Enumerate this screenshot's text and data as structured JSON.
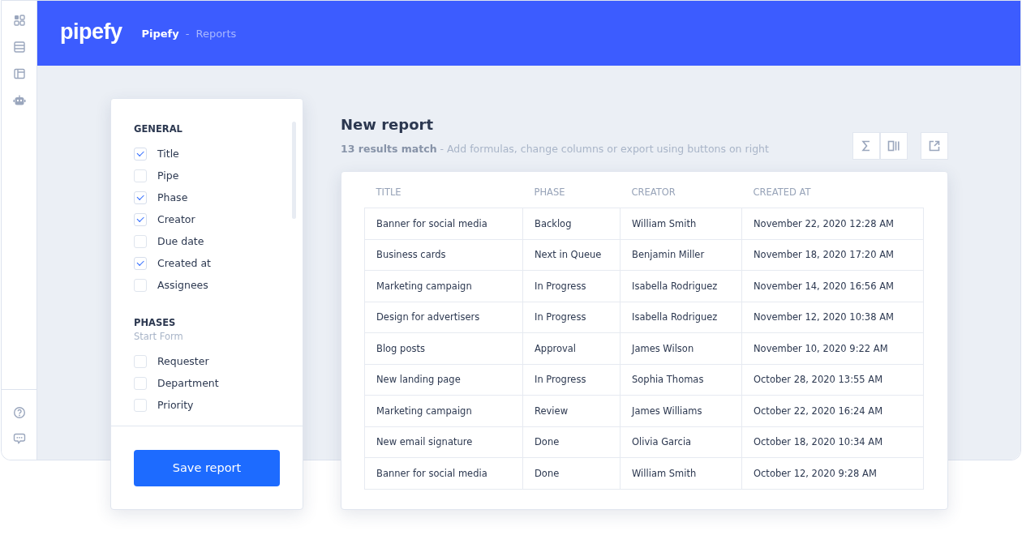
{
  "header": {
    "logo": "pipefy",
    "breadcrumb": [
      {
        "label": "Pipefy",
        "selected": true
      },
      {
        "label": "Reports",
        "selected": false
      }
    ],
    "separator": "-"
  },
  "fields_panel": {
    "sections": [
      {
        "title": "GENERAL",
        "items": [
          {
            "label": "Title",
            "checked": true
          },
          {
            "label": "Pipe",
            "checked": false
          },
          {
            "label": "Phase",
            "checked": true
          },
          {
            "label": "Creator",
            "checked": true
          },
          {
            "label": "Due date",
            "checked": false
          },
          {
            "label": "Created at",
            "checked": true
          },
          {
            "label": "Assignees",
            "checked": false
          }
        ]
      },
      {
        "title": "PHASES",
        "subtitle": "Start Form",
        "items": [
          {
            "label": "Requester",
            "checked": false
          },
          {
            "label": "Department",
            "checked": false
          },
          {
            "label": "Priority",
            "checked": false
          }
        ]
      }
    ],
    "save_button": "Save report"
  },
  "report": {
    "title": "New report",
    "count": "13 results match",
    "hint": " - Add formulas, change columns or export using buttons on right",
    "table": {
      "columns": [
        "TITLE",
        "PHASE",
        "CREATOR",
        "CREATED AT"
      ],
      "rows": [
        [
          "Banner for social media",
          "Backlog",
          "William Smith",
          "November 22, 2020 12:28 AM"
        ],
        [
          "Business cards",
          "Next in Queue",
          "Benjamin Miller",
          "November 18, 2020 17:20 AM"
        ],
        [
          "Marketing campaign",
          "In Progress",
          "Isabella Rodriguez",
          "November 14, 2020 16:56 AM"
        ],
        [
          "Design for advertisers",
          "In Progress",
          "Isabella Rodriguez",
          "November 12, 2020 10:38 AM"
        ],
        [
          "Blog posts",
          "Approval",
          "James Wilson",
          "November 10, 2020 9:22 AM"
        ],
        [
          "New landing page",
          "In Progress",
          "Sophia Thomas",
          "October 28, 2020 13:55 AM"
        ],
        [
          "Marketing campaign",
          "Review",
          "James Williams",
          "October 22, 2020 16:24 AM"
        ],
        [
          "New email signature",
          "Done",
          "Olivia Garcia",
          "October 18, 2020 10:34 AM"
        ],
        [
          "Banner for social media",
          "Done",
          "William Smith",
          "October 12, 2020 9:28 AM"
        ]
      ]
    }
  }
}
